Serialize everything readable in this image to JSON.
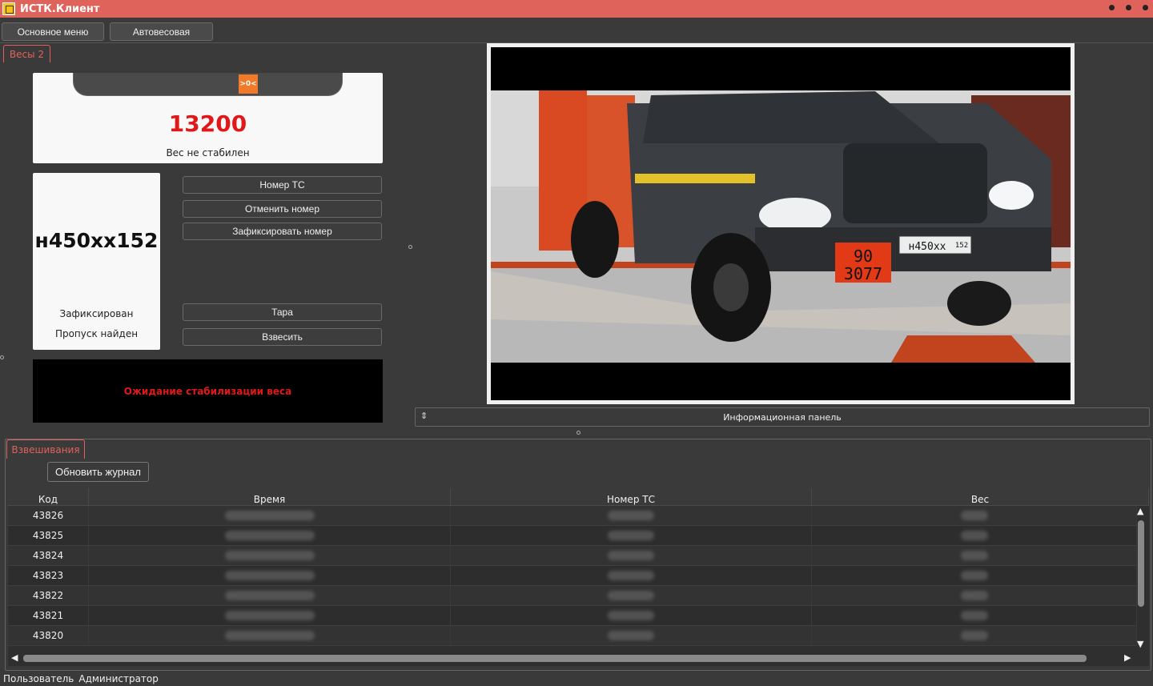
{
  "window": {
    "title": "ИСТК.Клиент"
  },
  "menu": {
    "main_label": "Основное меню",
    "scales_label": "Автовесовая"
  },
  "scale_tab": {
    "label": "Весы 2"
  },
  "weight": {
    "zero_indicator": ">0<",
    "value": "13200",
    "status": "Вес не стабилен"
  },
  "plate": {
    "number": "н450хх152",
    "status_fixed": "Зафиксирован",
    "status_pass": "Пропуск найден"
  },
  "actions": {
    "vehicle_number": "Номер ТС",
    "cancel_number": "Отменить номер",
    "fix_number": "Зафиксировать номер",
    "tare": "Тара",
    "weigh": "Взвесить"
  },
  "status_message": "Ожидание стабилизации веса",
  "camera": {
    "plate_region": "90",
    "plate_un": "3077",
    "plate_text": "н450хх",
    "plate_region_code": "152"
  },
  "info_panel": {
    "label": "Информационная панель"
  },
  "journal": {
    "tab_label": "Взвешивания",
    "refresh_label": "Обновить журнал",
    "columns": [
      "Код",
      "Время",
      "Номер ТС",
      "Вес"
    ],
    "rows": [
      {
        "code": "43826"
      },
      {
        "code": "43825"
      },
      {
        "code": "43824"
      },
      {
        "code": "43823"
      },
      {
        "code": "43822"
      },
      {
        "code": "43821"
      },
      {
        "code": "43820"
      }
    ]
  },
  "statusbar": {
    "user_label": "Пользователь",
    "user_name": "Администратор"
  },
  "colors": {
    "accent": "#e0635b",
    "weight_red": "#e01818",
    "zero_badge": "#f07a2a"
  }
}
